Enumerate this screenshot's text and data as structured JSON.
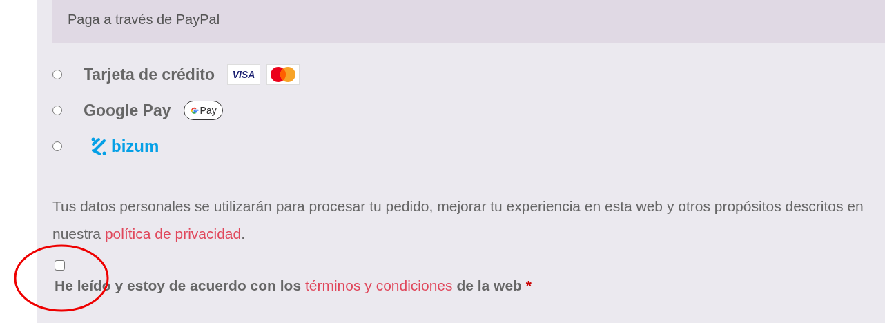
{
  "notice": {
    "text": "Paga a través de PayPal"
  },
  "payment_methods": [
    {
      "label": "Tarjeta de crédito",
      "selected": false,
      "logos": [
        {
          "kind": "visa",
          "text": "VISA"
        },
        {
          "kind": "mastercard"
        }
      ]
    },
    {
      "label": "Google Pay",
      "selected": false,
      "logos": [
        {
          "kind": "gpay",
          "text": "Pay"
        }
      ]
    },
    {
      "selected": false,
      "logos": [
        {
          "kind": "bizum",
          "text": "bizum"
        }
      ]
    }
  ],
  "privacy": {
    "text_before": "Tus datos personales se utilizarán para procesar tu pedido, mejorar tu experiencia en esta web y otros propósitos descritos en nuestra ",
    "link": "política de privacidad",
    "text_after": "."
  },
  "terms": {
    "checked": false,
    "text_before": "He leído y estoy de acuerdo con los ",
    "link": "términos y condiciones",
    "text_after": " de la web",
    "required_mark": "*"
  }
}
